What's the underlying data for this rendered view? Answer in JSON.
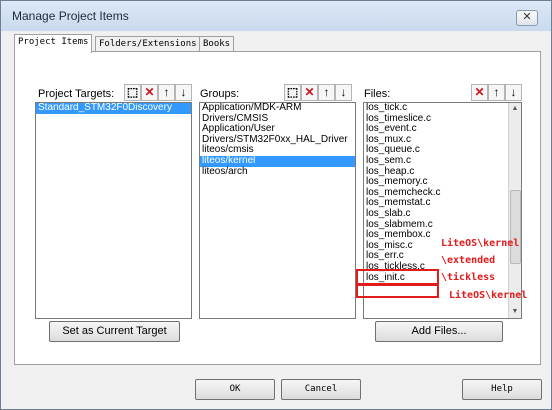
{
  "window": {
    "title": "Manage Project Items",
    "close_glyph": "✕"
  },
  "tabs": [
    "Project Items",
    "Folders/Extensions",
    "Books"
  ],
  "targets": {
    "label": "Project Targets:",
    "items": [
      "Standard_STM32F0Discovery"
    ]
  },
  "groups": {
    "label": "Groups:",
    "items": [
      "Application/MDK-ARM",
      "Drivers/CMSIS",
      "Application/User",
      "Drivers/STM32F0xx_HAL_Driver",
      "liteos/cmsis",
      "liteos/kernel",
      "liteos/arch"
    ],
    "selected": "liteos/kernel"
  },
  "files": {
    "label": "Files:",
    "items": [
      "los_tick.c",
      "los_timeslice.c",
      "los_event.c",
      "los_mux.c",
      "los_queue.c",
      "los_sem.c",
      "los_heap.c",
      "los_memory.c",
      "los_memcheck.c",
      "los_memstat.c",
      "los_slab.c",
      "los_slabmem.c",
      "los_membox.c",
      "los_misc.c",
      "los_err.c",
      "los_tickless.c",
      "los_init.c"
    ]
  },
  "toolbar_icons": [
    "new-item-icon",
    "delete-icon",
    "move-up-icon",
    "move-down-icon"
  ],
  "glyphs": {
    "new": "⬚",
    "delete": "✕",
    "up": "↑",
    "down": "↓",
    "scroll_up": "▲",
    "scroll_down": "▼",
    "grip": "≡"
  },
  "buttons": {
    "set_current_target": "Set as Current Target",
    "add_files": "Add Files...",
    "ok": "OK",
    "cancel": "Cancel",
    "help": "Help"
  },
  "annotations": {
    "tickless_path": "LiteOS\\kernel\n\\extended\n\\tickless",
    "init_path": "LiteOS\\kernel"
  },
  "colors": {
    "selection": "#3399ff",
    "annotation": "#e21b1b"
  }
}
